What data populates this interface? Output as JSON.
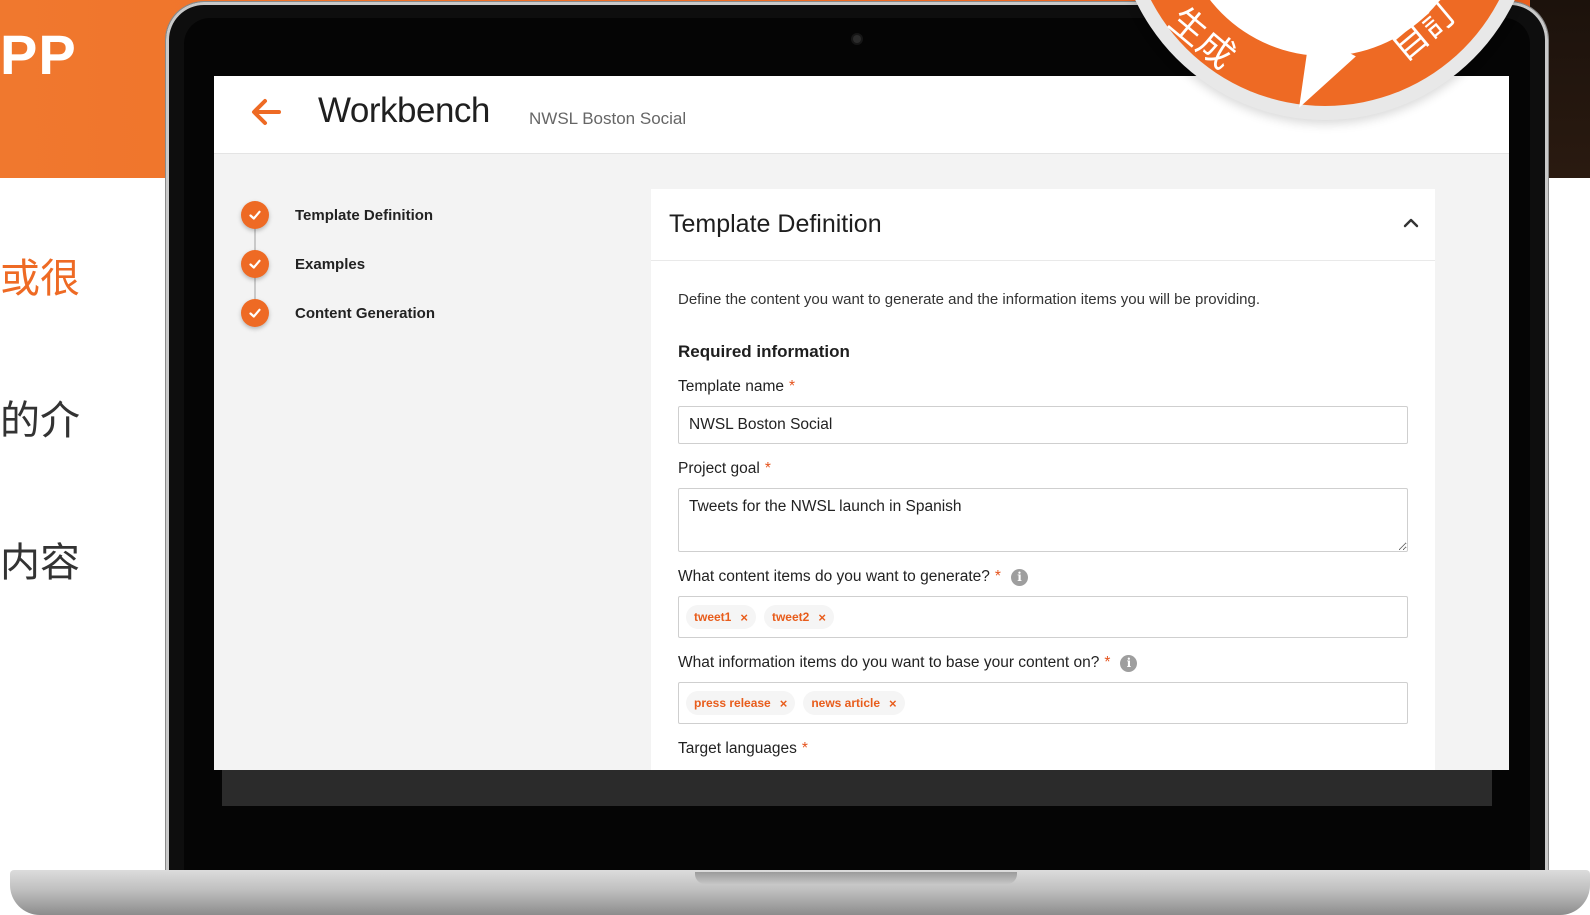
{
  "background": {
    "banner_fragment": "PP",
    "side_text_1": "或很",
    "side_text_2": "的介",
    "side_text_3": "内容",
    "badge_left": "生成",
    "badge_right": "自訂",
    "accent_color": "#ee6a24"
  },
  "header": {
    "back_icon": "arrow-left-icon",
    "title": "Workbench",
    "subtitle": "NWSL Boston Social"
  },
  "stepper": {
    "steps": [
      {
        "label": "Template Definition",
        "status": "complete"
      },
      {
        "label": "Examples",
        "status": "complete"
      },
      {
        "label": "Content Generation",
        "status": "complete"
      }
    ]
  },
  "panel": {
    "title": "Template Definition",
    "description": "Define the content you want to generate and the information items you will be providing.",
    "required_heading": "Required information",
    "template_name": {
      "label": "Template name",
      "required_mark": "*",
      "value": "NWSL Boston Social"
    },
    "project_goal": {
      "label": "Project goal",
      "required_mark": "*",
      "value": "Tweets for the NWSL launch in Spanish"
    },
    "content_items": {
      "label": "What content items do you want to generate?",
      "required_mark": "*",
      "info_glyph": "i",
      "chips": [
        {
          "label": "tweet1",
          "remove": "×"
        },
        {
          "label": "tweet2",
          "remove": "×"
        }
      ]
    },
    "information_items": {
      "label": "What information items do you want to base your content on?",
      "required_mark": "*",
      "info_glyph": "i",
      "chips": [
        {
          "label": "press release",
          "remove": "×"
        },
        {
          "label": "news article",
          "remove": "×"
        }
      ]
    },
    "target_languages": {
      "label": "Target languages",
      "required_mark": "*"
    }
  }
}
